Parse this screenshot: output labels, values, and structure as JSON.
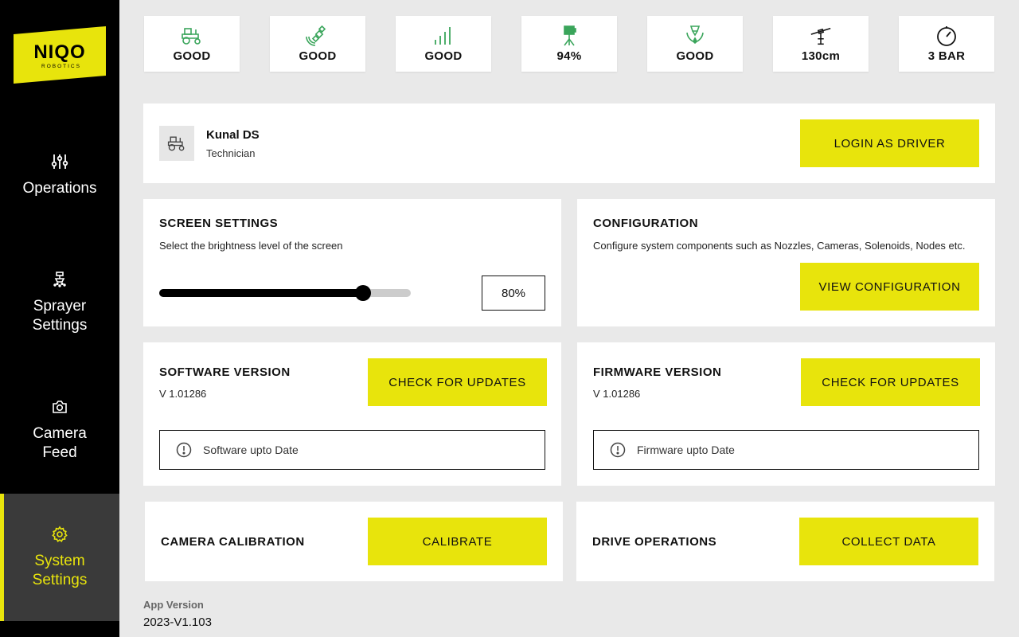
{
  "brand": {
    "logo_text": "NIQO",
    "logo_sub": "ROBOTICS",
    "color": "#e8e40c"
  },
  "sidebar": {
    "items": [
      {
        "label": "Operations",
        "icon": "sliders-icon",
        "active": false
      },
      {
        "label": "Sprayer\nSettings",
        "icon": "sprayer-icon",
        "active": false
      },
      {
        "label": "Camera\nFeed",
        "icon": "camera-icon",
        "active": false
      },
      {
        "label": "System\nSettings",
        "icon": "gear-icon",
        "active": true
      }
    ]
  },
  "status_tiles": [
    {
      "icon": "tractor-icon",
      "value": "GOOD"
    },
    {
      "icon": "satellite-icon",
      "value": "GOOD"
    },
    {
      "icon": "signal-icon",
      "value": "GOOD"
    },
    {
      "icon": "battery-tripod-icon",
      "value": "94%"
    },
    {
      "icon": "nozzle-icon",
      "value": "GOOD"
    },
    {
      "icon": "boom-height-icon",
      "value": "130cm"
    },
    {
      "icon": "pressure-gauge-icon",
      "value": "3 BAR"
    }
  ],
  "user": {
    "name": "Kunal DS",
    "role": "Technician",
    "login_button": "LOGIN AS DRIVER"
  },
  "screen_settings": {
    "title": "SCREEN SETTINGS",
    "subtitle": "Select the brightness level of the screen",
    "brightness_label": "80%",
    "brightness_fraction": 0.81
  },
  "configuration": {
    "title": "CONFIGURATION",
    "subtitle": "Configure system components such as Nozzles, Cameras, Solenoids, Nodes etc.",
    "button": "VIEW CONFIGURATION"
  },
  "software": {
    "title": "SOFTWARE VERSION",
    "version": "V 1.01286",
    "button": "CHECK FOR UPDATES",
    "status": "Software upto Date"
  },
  "firmware": {
    "title": "FIRMWARE VERSION",
    "version": "V 1.01286",
    "button": "CHECK FOR UPDATES",
    "status": "Firmware upto Date"
  },
  "camera_calibration": {
    "title": "CAMERA CALIBRATION",
    "button": "CALIBRATE"
  },
  "drive_operations": {
    "title": "DRIVE OPERATIONS",
    "button": "COLLECT DATA"
  },
  "app_version": {
    "label": "App Version",
    "value": "2023-V1.103"
  }
}
